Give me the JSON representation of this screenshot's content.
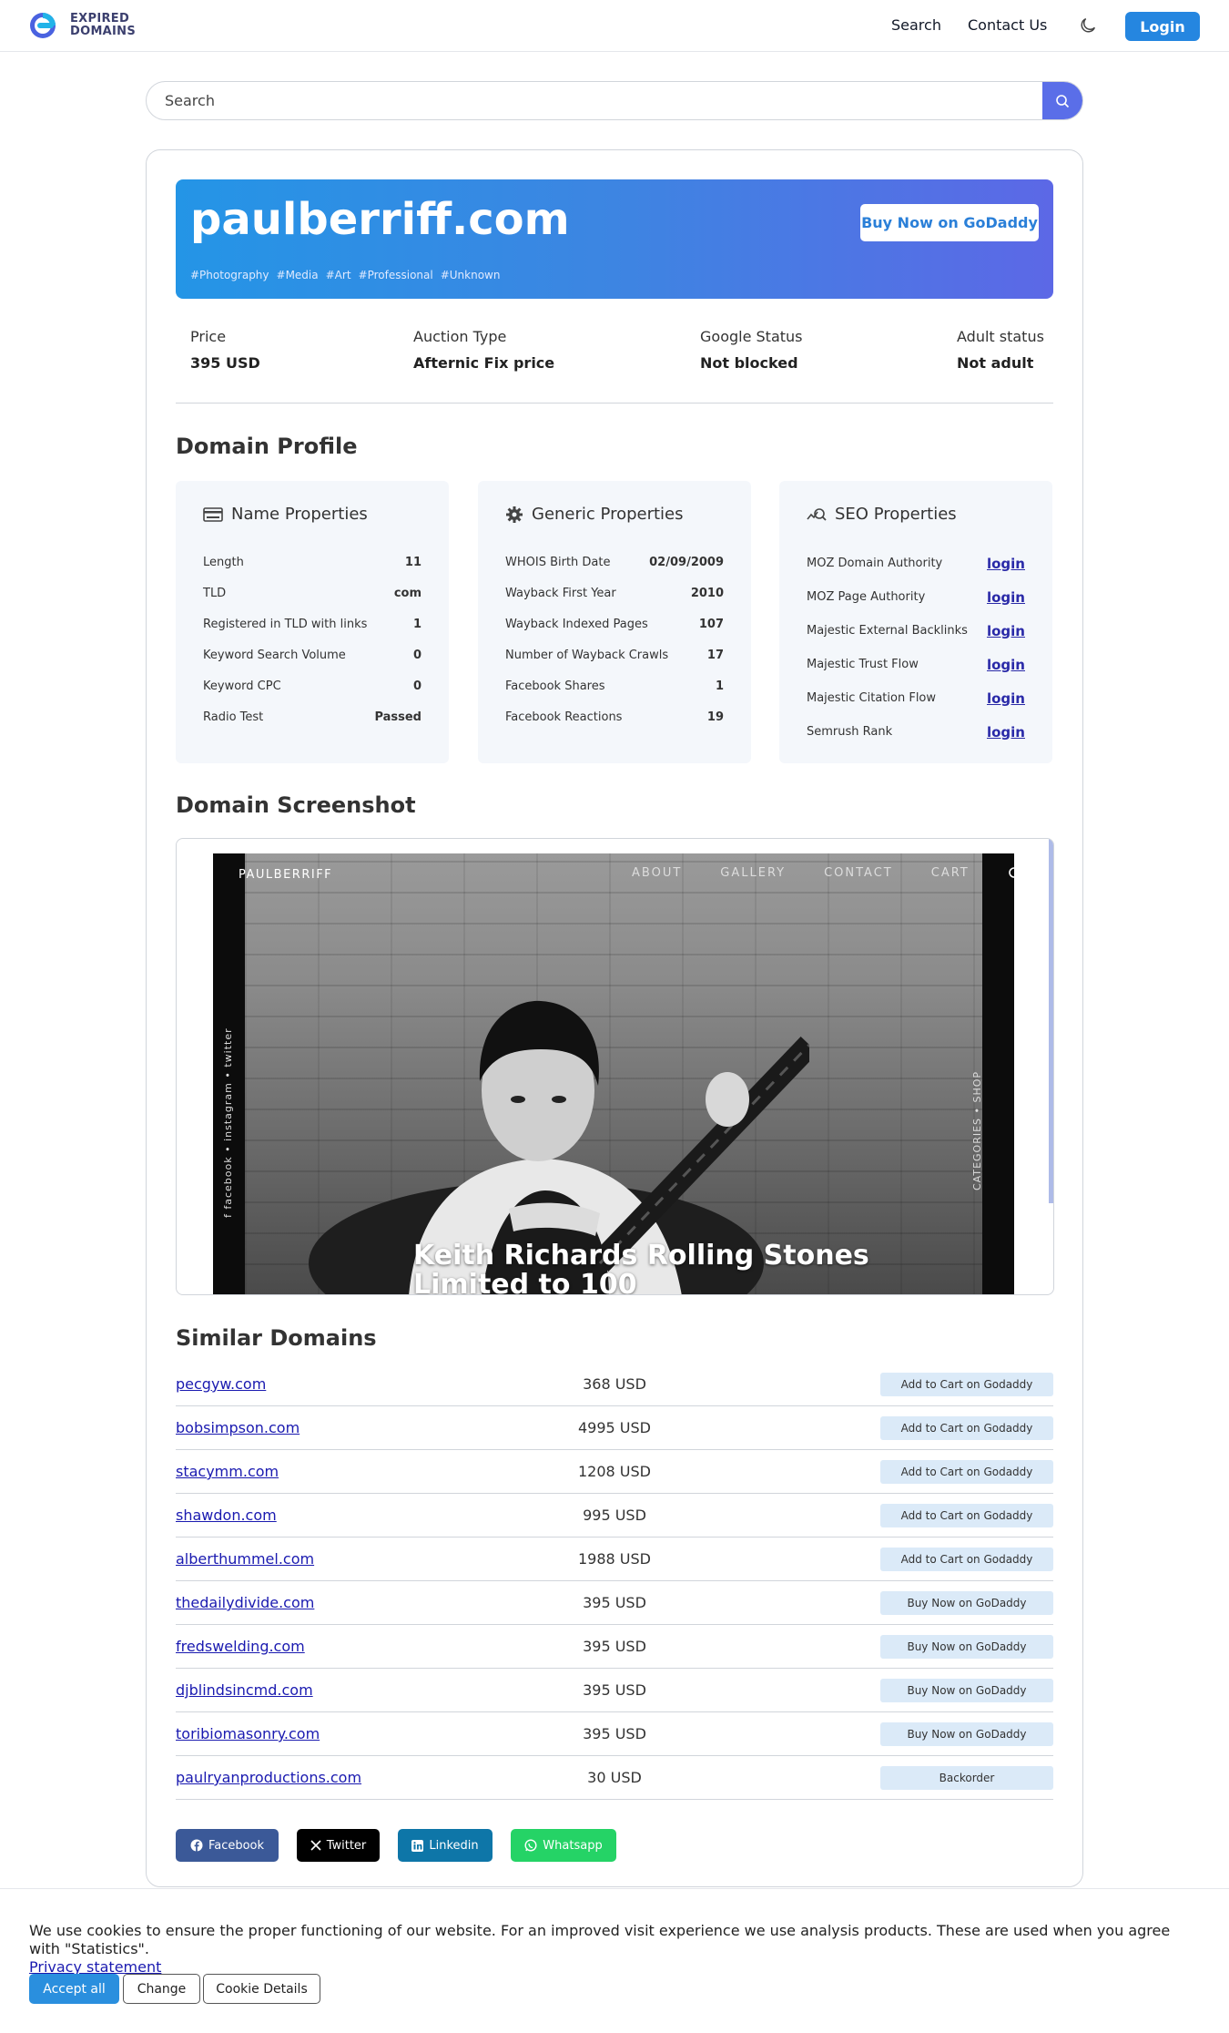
{
  "nav": {
    "logo_line1": "EXPIRED",
    "logo_line2": "DOMAINS",
    "search_label": "Search",
    "contact_label": "Contact Us",
    "login_label": "Login"
  },
  "search": {
    "placeholder": "Search"
  },
  "hero": {
    "domain": "paulberriff.com",
    "tags": [
      "#Photography",
      "#Media",
      "#Art",
      "#Professional",
      "#Unknown"
    ],
    "buy_label": "Buy Now on GoDaddy"
  },
  "stats": [
    {
      "label": "Price",
      "value": "395 USD"
    },
    {
      "label": "Auction Type",
      "value": "Afternic Fix price"
    },
    {
      "label": "Google Status",
      "value": "Not blocked"
    },
    {
      "label": "Adult status",
      "value": "Not adult"
    }
  ],
  "profile": {
    "title": "Domain Profile",
    "name_props": {
      "title": "Name Properties",
      "rows": [
        {
          "label": "Length",
          "value": "11"
        },
        {
          "label": "TLD",
          "value": "com"
        },
        {
          "label": "Registered in TLD with links",
          "value": "1"
        },
        {
          "label": "Keyword Search Volume",
          "value": "0"
        },
        {
          "label": "Keyword CPC",
          "value": "0"
        },
        {
          "label": "Radio Test",
          "value": "Passed"
        }
      ]
    },
    "generic_props": {
      "title": "Generic Properties",
      "rows": [
        {
          "label": "WHOIS Birth Date",
          "value": "02/09/2009"
        },
        {
          "label": "Wayback First Year",
          "value": "2010"
        },
        {
          "label": "Wayback Indexed Pages",
          "value": "107"
        },
        {
          "label": "Number of Wayback Crawls",
          "value": "17"
        },
        {
          "label": "Facebook Shares",
          "value": "1"
        },
        {
          "label": "Facebook Reactions",
          "value": "19"
        }
      ]
    },
    "seo_props": {
      "title": "SEO Properties",
      "rows": [
        {
          "label": "MOZ Domain Authority",
          "value": "login"
        },
        {
          "label": "MOZ Page Authority",
          "value": "login"
        },
        {
          "label": "Majestic External Backlinks",
          "value": "login"
        },
        {
          "label": "Majestic Trust Flow",
          "value": "login"
        },
        {
          "label": "Majestic Citation Flow",
          "value": "login"
        },
        {
          "label": "Semrush Rank",
          "value": "login"
        }
      ]
    }
  },
  "screenshot": {
    "title": "Domain Screenshot",
    "site_brand": "PAULBERRIFF",
    "site_menu": [
      "ABOUT",
      "GALLERY",
      "CONTACT",
      "CART"
    ],
    "side_left": "f  facebook  •  instagram  •  twitter",
    "side_right": "CATEGORIES  •  SHOP",
    "caption_line1": "Keith Richards Rolling Stones",
    "caption_line2": "Limited to 100"
  },
  "similar": {
    "title": "Similar Domains",
    "rows": [
      {
        "name": "pecgyw.com",
        "price": "368 USD",
        "action": "Add to Cart on Godaddy"
      },
      {
        "name": "bobsimpson.com",
        "price": "4995 USD",
        "action": "Add to Cart on Godaddy"
      },
      {
        "name": "stacymm.com",
        "price": "1208 USD",
        "action": "Add to Cart on Godaddy"
      },
      {
        "name": "shawdon.com",
        "price": "995 USD",
        "action": "Add to Cart on Godaddy"
      },
      {
        "name": "alberthummel.com",
        "price": "1988 USD",
        "action": "Add to Cart on Godaddy"
      },
      {
        "name": "thedailydivide.com",
        "price": "395 USD",
        "action": "Buy Now on GoDaddy"
      },
      {
        "name": "fredswelding.com",
        "price": "395 USD",
        "action": "Buy Now on GoDaddy"
      },
      {
        "name": "djblindsincmd.com",
        "price": "395 USD",
        "action": "Buy Now on GoDaddy"
      },
      {
        "name": "toribiomasonry.com",
        "price": "395 USD",
        "action": "Buy Now on GoDaddy"
      },
      {
        "name": "paulryanproductions.com",
        "price": "30 USD",
        "action": "Backorder"
      }
    ]
  },
  "share": {
    "facebook": "Facebook",
    "twitter": "Twitter",
    "linkedin": "Linkedin",
    "whatsapp": "Whatsapp",
    "colors": {
      "facebook": "#3b5998",
      "twitter": "#000000",
      "linkedin": "#0e76a8",
      "whatsapp": "#25d366"
    }
  },
  "cookie": {
    "text": "We use cookies to ensure the proper functioning of our website. For an improved visit experience we use analysis products. These are used when you agree with \"Statistics\".",
    "privacy_link": "Privacy statement",
    "accept_label": "Accept all",
    "change_label": "Change",
    "details_label": "Cookie Details"
  },
  "colors": {
    "accent": "#2586e0",
    "hero_start": "#2495e6",
    "hero_end": "#5c68e6",
    "search_button": "#5a6ee8"
  }
}
